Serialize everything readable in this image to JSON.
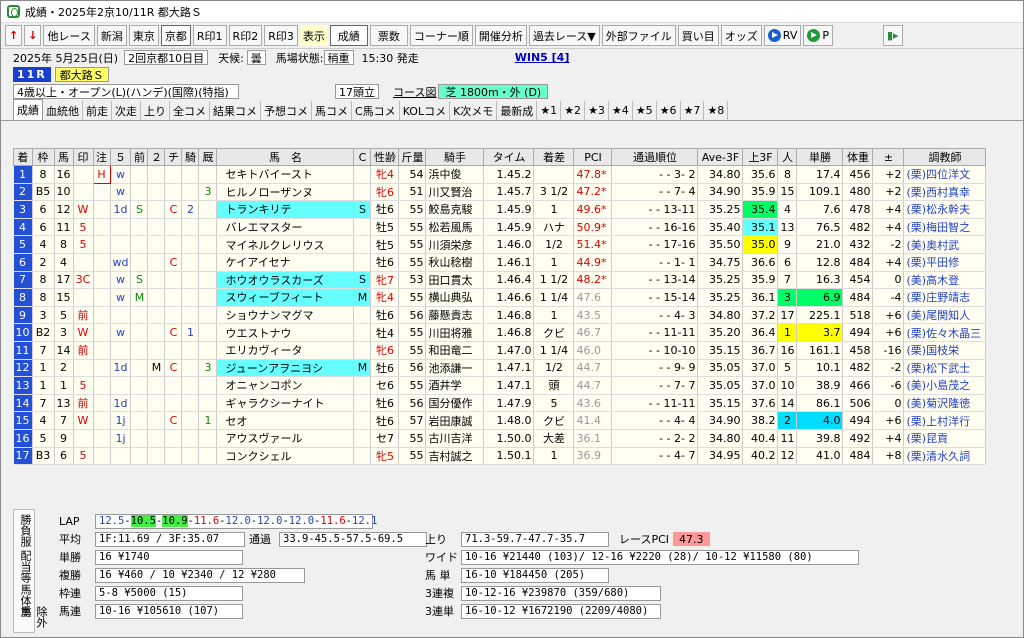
{
  "window_title": "成績・2025年2京10/11R 都大路Ｓ",
  "toolbar": {
    "other_race": "他レース",
    "venues": [
      "新潟",
      "東京",
      "京都"
    ],
    "rmarks": [
      "R印1",
      "R印2",
      "R印3"
    ],
    "display": "表示",
    "seiseki": "成績",
    "hyousuu": "票数",
    "corner": "コーナー順",
    "kaisai": "開催分析",
    "kako": "過去レース▼",
    "gaibu": "外部ファイル",
    "kaime": "買い目",
    "odds": "オッズ",
    "rv": "RV",
    "p": "P"
  },
  "info": {
    "date": "2025年 5月25日(日)",
    "kaisai": "2回京都10日目",
    "weather_label": "天候:",
    "weather": "曇",
    "track_label": "馬場状態:",
    "track": "稍重",
    "start": "15:30 発走",
    "win5": "WIN5 [4]",
    "race_no": "11R",
    "race_name": "都大路Ｓ",
    "conditions": "4歳以上・オープン(L)(ハンデ)(国際)(特指)",
    "heads": "17頭立",
    "course_label": "コース図",
    "course": "芝 1800m・外 (D)"
  },
  "tabs": [
    "成績",
    "血統他",
    "前走",
    "次走",
    "上り",
    "全コメ",
    "結果コメ",
    "予想コメ",
    "馬コメ",
    "C馬コメ",
    "KOLコメ",
    "K次メモ",
    "最新成",
    "★1",
    "★2",
    "★3",
    "★4",
    "★5",
    "★6",
    "★7",
    "★8"
  ],
  "columns": [
    "着",
    "枠",
    "馬",
    "印",
    "注",
    "５",
    "前",
    "２",
    "チ",
    "騎",
    "厩",
    "馬　名",
    "C",
    "性齢",
    "斤量",
    "騎手",
    "タイム",
    "着差",
    "PCI",
    "通過順位",
    "Ave-3F",
    "上3F",
    "人",
    "単勝",
    "体重",
    "±",
    "調教師"
  ],
  "rows": [
    [
      "1",
      "8",
      "16",
      "",
      "H",
      "w",
      "",
      "",
      "",
      "",
      "",
      "セキトバイースト",
      "",
      "牝4",
      "54",
      "浜中俊",
      "1.45.2",
      "",
      "47.8*",
      "-  -  3-  2",
      "34.80",
      "35.6",
      "8",
      "17.4",
      "456",
      "+2",
      "(栗)四位洋文"
    ],
    [
      "2",
      "B5",
      "10",
      "",
      "",
      "w",
      "",
      "",
      "",
      "",
      "3",
      "ヒルノローザンヌ",
      "",
      "牝6",
      "51",
      "川又賢治",
      "1.45.7",
      "3 1/2",
      "47.2*",
      "-  -  7-  4",
      "34.90",
      "35.9",
      "15",
      "109.1",
      "480",
      "+2",
      "(栗)西村真幸"
    ],
    [
      "3",
      "6",
      "12",
      "W",
      "",
      "1d",
      "S",
      "",
      "C",
      "2",
      "",
      "トランキリテ",
      "S",
      "牡6",
      "55",
      "鮫島克駿",
      "1.45.9",
      "1",
      "49.6*",
      "-  - 13-11",
      "35.25",
      "35.4",
      "4",
      "7.6",
      "478",
      "+4",
      "(栗)松永幹夫"
    ],
    [
      "4",
      "6",
      "11",
      "5",
      "",
      "",
      "",
      "",
      "",
      "",
      "",
      "バレエマスター",
      "",
      "牡5",
      "55",
      "松若風馬",
      "1.45.9",
      "ハナ",
      "50.9*",
      "-  - 16-16",
      "35.40",
      "35.1",
      "13",
      "76.5",
      "482",
      "+4",
      "(栗)梅田智之"
    ],
    [
      "5",
      "4",
      "8",
      "5",
      "",
      "",
      "",
      "",
      "",
      "",
      "",
      "マイネルクレリウス",
      "",
      "牡5",
      "55",
      "川須栄彦",
      "1.46.0",
      "1/2",
      "51.4*",
      "-  - 17-16",
      "35.50",
      "35.0",
      "9",
      "21.0",
      "432",
      "-2",
      "(美)奥村武"
    ],
    [
      "6",
      "2",
      "4",
      "",
      "",
      "wd",
      "",
      "",
      "C",
      "",
      "",
      "ケイアイセナ",
      "",
      "牡6",
      "55",
      "秋山稔樹",
      "1.46.1",
      "1",
      "44.9*",
      "-  -  1-  1",
      "34.75",
      "36.6",
      "6",
      "12.8",
      "484",
      "+4",
      "(栗)平田修"
    ],
    [
      "7",
      "8",
      "17",
      "3C",
      "",
      "w",
      "S",
      "",
      "",
      "",
      "",
      "ホウオウラスカーズ",
      "S",
      "牝7",
      "53",
      "田口貫太",
      "1.46.4",
      "1 1/2",
      "48.2*",
      "-  - 13-14",
      "35.25",
      "35.9",
      "7",
      "16.3",
      "454",
      "0",
      "(美)高木登"
    ],
    [
      "8",
      "8",
      "15",
      "",
      "",
      "w",
      "M",
      "",
      "",
      "",
      "",
      "スウィーブフィート",
      "M",
      "牝4",
      "55",
      "横山典弘",
      "1.46.6",
      "1 1/4",
      "47.6",
      "-  - 15-14",
      "35.25",
      "36.1",
      "3",
      "6.9",
      "484",
      "-4",
      "(栗)庄野靖志"
    ],
    [
      "9",
      "3",
      "5",
      "前",
      "",
      "",
      "",
      "",
      "",
      "",
      "",
      "ショウナンマグマ",
      "",
      "牡6",
      "56",
      "藤懸貴志",
      "1.46.8",
      "1",
      "43.5",
      "-  -  4-  3",
      "34.80",
      "37.2",
      "17",
      "225.1",
      "518",
      "+6",
      "(美)尾関知人"
    ],
    [
      "10",
      "B2",
      "3",
      "W",
      "",
      "w",
      "",
      "",
      "C",
      "1",
      "",
      "ウエストナウ",
      "",
      "牡4",
      "55",
      "川田将雅",
      "1.46.8",
      "クビ",
      "46.7",
      "-  - 11-11",
      "35.20",
      "36.4",
      "1",
      "3.7",
      "494",
      "+6",
      "(栗)佐々木晶三"
    ],
    [
      "11",
      "7",
      "14",
      "前",
      "",
      "",
      "",
      "",
      "",
      "",
      "",
      "エリカヴィータ",
      "",
      "牝6",
      "55",
      "和田竜二",
      "1.47.0",
      "1 1/4",
      "46.0",
      "-  - 10-10",
      "35.15",
      "36.7",
      "16",
      "161.1",
      "458",
      "-16",
      "(栗)国枝栄"
    ],
    [
      "12",
      "1",
      "2",
      "",
      "",
      "1d",
      "",
      "M",
      "C",
      "",
      "3",
      "ジューンアヲニヨシ",
      "M",
      "牡6",
      "56",
      "池添謙一",
      "1.47.1",
      "1/2",
      "44.7",
      "-  -  9-  9",
      "35.05",
      "37.0",
      "5",
      "10.1",
      "482",
      "-2",
      "(栗)松下武士"
    ],
    [
      "13",
      "1",
      "1",
      "5",
      "",
      "",
      "",
      "",
      "",
      "",
      "",
      "オニャンコポン",
      "",
      "セ6",
      "55",
      "酒井学",
      "1.47.1",
      "頭",
      "44.7",
      "-  -  7-  7",
      "35.05",
      "37.0",
      "10",
      "38.9",
      "466",
      "-6",
      "(美)小島茂之"
    ],
    [
      "14",
      "7",
      "13",
      "前",
      "",
      "1d",
      "",
      "",
      "",
      "",
      "",
      "ギャラクシーナイト",
      "",
      "牡6",
      "56",
      "国分優作",
      "1.47.9",
      "5",
      "43.6",
      "-  - 11-11",
      "35.15",
      "37.6",
      "14",
      "86.1",
      "506",
      "0",
      "(美)菊沢隆徳"
    ],
    [
      "15",
      "4",
      "7",
      "W",
      "",
      "1j",
      "",
      "",
      "C",
      "",
      "1",
      "セオ",
      "",
      "牡6",
      "57",
      "岩田康誠",
      "1.48.0",
      "クビ",
      "41.4",
      "-  -  4-  4",
      "34.90",
      "38.2",
      "2",
      "4.0",
      "494",
      "+6",
      "(栗)上村洋行"
    ],
    [
      "16",
      "5",
      "9",
      "",
      "",
      "1j",
      "",
      "",
      "",
      "",
      "",
      "アウスヴァール",
      "",
      "セ7",
      "55",
      "古川吉洋",
      "1.50.0",
      "大差",
      "36.1",
      "-  -  2-  2",
      "34.80",
      "40.4",
      "11",
      "39.8",
      "492",
      "+4",
      "(栗)昆貢"
    ],
    [
      "17",
      "B3",
      "6",
      "5",
      "",
      "",
      "",
      "",
      "",
      "",
      "",
      "コンクシェル",
      "",
      "牝5",
      "55",
      "吉村誠之",
      "1.50.1",
      "1",
      "36.9",
      "-  -  4-  7",
      "34.95",
      "40.2",
      "12",
      "41.0",
      "484",
      "+8",
      "(栗)清水久詞"
    ]
  ],
  "bottom": {
    "side_labels": [
      "勝負服",
      "配当等",
      "馬体重",
      "除外馬"
    ],
    "lap_label": "LAP",
    "lap": [
      "12.5",
      "10.5",
      "10.9",
      "11.6",
      "12.0",
      "12.0",
      "12.0",
      "11.6",
      "12.1"
    ],
    "avg_label": "平均",
    "avg": "1F:11.69 / 3F:35.07",
    "tsuuka_label": "通過",
    "tsuuka": "33.9-45.5-57.5-69.5",
    "agari_label": "上り",
    "agari": "71.3-59.7-47.7-35.7",
    "pci_label": "レースPCI",
    "pci": "47.3",
    "tansho_label": "単勝",
    "tansho": "16 ¥1740",
    "fukusho_label": "複勝",
    "fukusho": "16 ¥460 / 10 ¥2340 / 12 ¥280",
    "wakuren_label": "枠連",
    "wakuren": "5-8 ¥5000 (15)",
    "umaren_label": "馬連",
    "umaren": "10-16 ¥105610 (107)",
    "wide_label": "ワイド",
    "wide": "10-16 ¥21440 (103)/ 12-16 ¥2220 (28)/ 10-12 ¥11580 (80)",
    "umatan_label": "馬 単",
    "umatan": "16-10 ¥184450 (205)",
    "sanrenpuku_label": "3連複",
    "sanrenpuku": "10-12-16 ¥239870 (359/680)",
    "sanrentan_label": "3連単",
    "sanrentan": "16-10-12 ¥1672190 (2209/4080)"
  },
  "colors": {
    "red": "#d00000",
    "blue": "#2243c8",
    "up3f_first": "#00ff66",
    "cyan": "#66ffff",
    "gate": "#2450d8"
  }
}
